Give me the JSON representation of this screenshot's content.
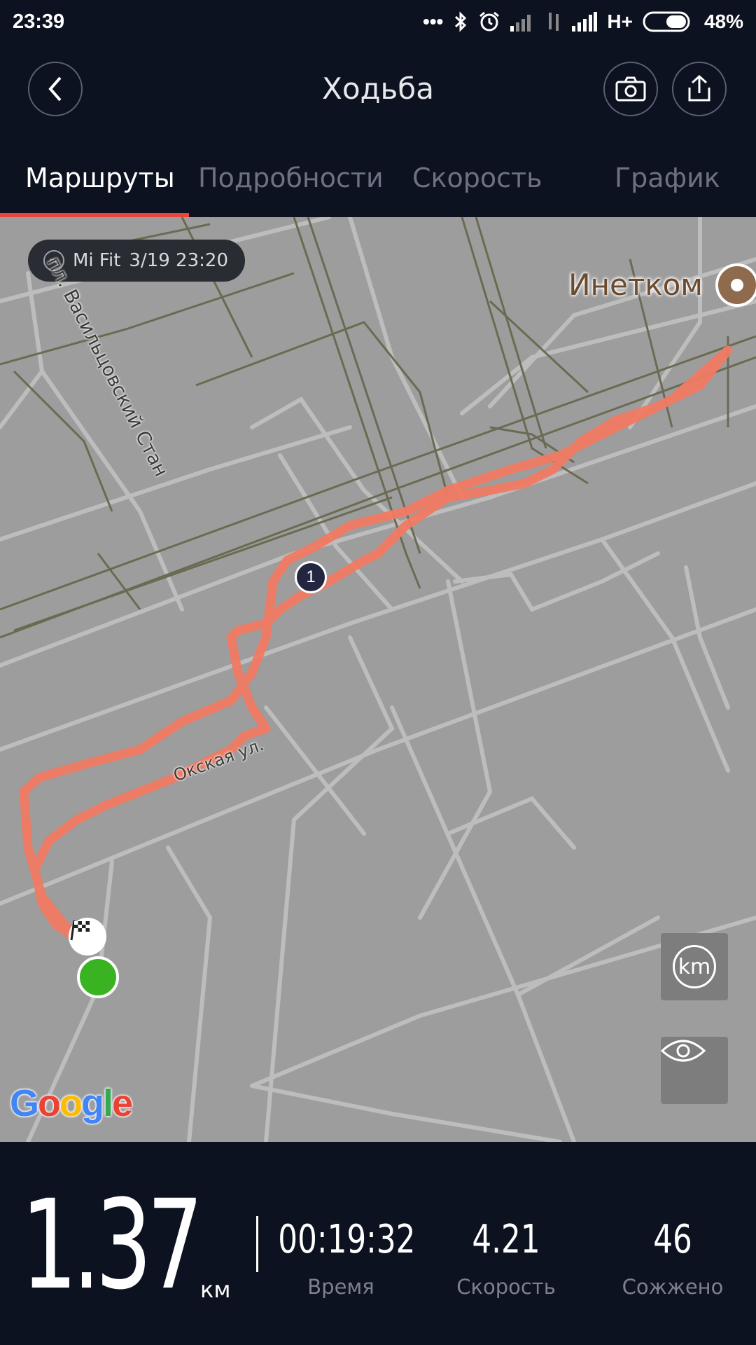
{
  "status_bar": {
    "time": "23:39",
    "network": "H+",
    "battery": "48%"
  },
  "header": {
    "title": "Ходьба",
    "icons": [
      "back-icon",
      "camera-icon",
      "share-icon"
    ]
  },
  "tabs": [
    {
      "label": "Маршруты",
      "active": true
    },
    {
      "label": "Подробности",
      "active": false
    },
    {
      "label": "Скорость",
      "active": false
    },
    {
      "label": "График",
      "active": false
    }
  ],
  "map": {
    "source_chip": "Mi Fit",
    "source_date": "3/19 23:20",
    "poi_label": "Инетком",
    "streets": [
      "пл. Васильцовский Стан",
      "Окская ул."
    ],
    "km_marker": "1",
    "unit_button": "km",
    "attribution": "Google",
    "route_color": "#f07a62",
    "start_color": "#3ab322"
  },
  "summary": {
    "distance": "1.37",
    "distance_unit": "км",
    "time_value": "00:19:32",
    "time_label": "Время",
    "speed_value": "4.21",
    "speed_label": "Скорость",
    "calories_value": "46",
    "calories_label": "Сожжено"
  }
}
